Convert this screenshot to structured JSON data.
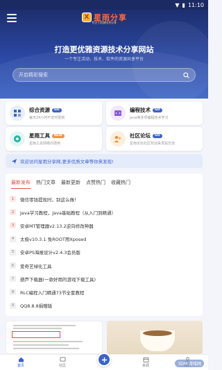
{
  "status": {
    "time": "11:10"
  },
  "header": {
    "logo_mark": "X",
    "logo_text": "星雨分享",
    "logo_sub": "专注于资源技术分享",
    "title": "打造更优雅资源技术分享网站",
    "subtitle": "一个专注活动、技术、软件的资源共享平台",
    "search_placeholder": "开启精彩搜索"
  },
  "cards": [
    {
      "title": "综合资源",
      "badge": "GO",
      "desc": "每天24小时不定时更新",
      "icon": "grid-icon"
    },
    {
      "title": "编程技术",
      "badge": "GO",
      "desc": "java等多项编程技术学习",
      "icon": "code-icon"
    },
    {
      "title": "星雨工具",
      "badge": "NEW",
      "desc": "星雨工具网络均便用",
      "icon": "tools-icon"
    },
    {
      "title": "社区论坛",
      "badge": "GO",
      "desc": "星雨论坛社区欢迎来发贴交流",
      "icon": "forum-icon"
    }
  ],
  "notice": "欢迎访问星雨分享网,更多优质文章等你来发现!",
  "tabs": [
    "最新发布",
    "热门文章",
    "最新更新",
    "点赞热门",
    "收藏热门"
  ],
  "articles": [
    {
      "num": "1",
      "title": "微信零钱提现时，别这么做！"
    },
    {
      "num": "2",
      "title": "Java学习教程，Java基础教程（从入门到精通）"
    },
    {
      "num": "3",
      "title": "安卓MT管理器v2.13.2逆向修改神器"
    },
    {
      "num": "4",
      "title": "太极v10.3.1 免ROOT用Xposed"
    },
    {
      "num": "5",
      "title": "安卓PS海报设计v2.4.3会员版"
    },
    {
      "num": "6",
      "title": "爱奇艺绿化工具"
    },
    {
      "num": "7",
      "title": "葫芦下载器(一款好用的游戏下载工具)"
    },
    {
      "num": "8",
      "title": "RLC编程入门精通73节全套教程"
    },
    {
      "num": "9",
      "title": "QQ8.8.8捐赠版"
    }
  ],
  "nav": [
    "首页",
    "社区",
    "",
    "资源",
    "我的"
  ],
  "watermark": "3DM 游戏网",
  "colors": {
    "primary": "#3b63c6",
    "hot": "#e54d42",
    "dark": "#1b2a63"
  }
}
